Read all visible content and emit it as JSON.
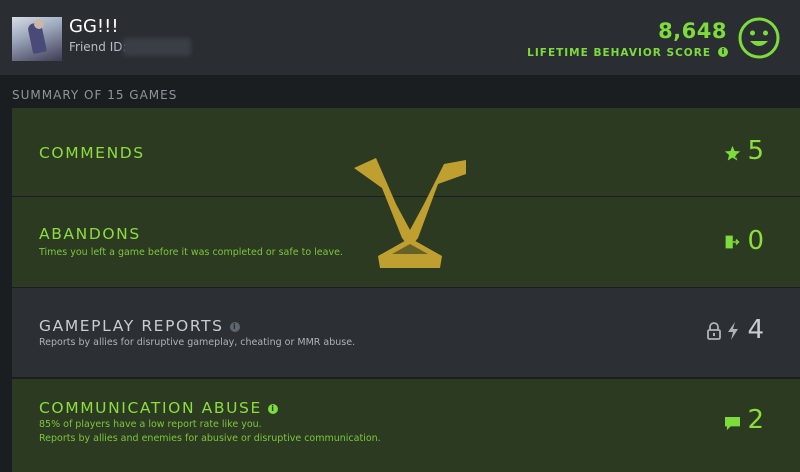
{
  "profile": {
    "name": "GG!!!",
    "friend_id_label": "Friend ID:"
  },
  "behavior": {
    "score": "8,648",
    "label": "LIFETIME BEHAVIOR SCORE"
  },
  "summary": {
    "title": "SUMMARY OF 15 GAMES"
  },
  "sections": {
    "commends": {
      "title": "COMMENDS",
      "count": "5"
    },
    "abandons": {
      "title": "ABANDONS",
      "description": "Times you left a game before it was completed or safe to leave.",
      "count": "0"
    },
    "gameplay_reports": {
      "title": "GAMEPLAY REPORTS",
      "description": "Reports by allies for disruptive gameplay, cheating or MMR abuse.",
      "count": "4"
    },
    "communication_abuse": {
      "title": "COMMUNICATION ABUSE",
      "description_line1": "85% of players have a low report rate like you.",
      "description_line2": "Reports by allies and enemies for abusive or disruptive communication.",
      "count": "2"
    }
  },
  "colors": {
    "accent_green": "#7ddb3c",
    "card_green": "#2c3a22",
    "card_gray": "#2c3034",
    "logo_gold": "#c8a532"
  }
}
